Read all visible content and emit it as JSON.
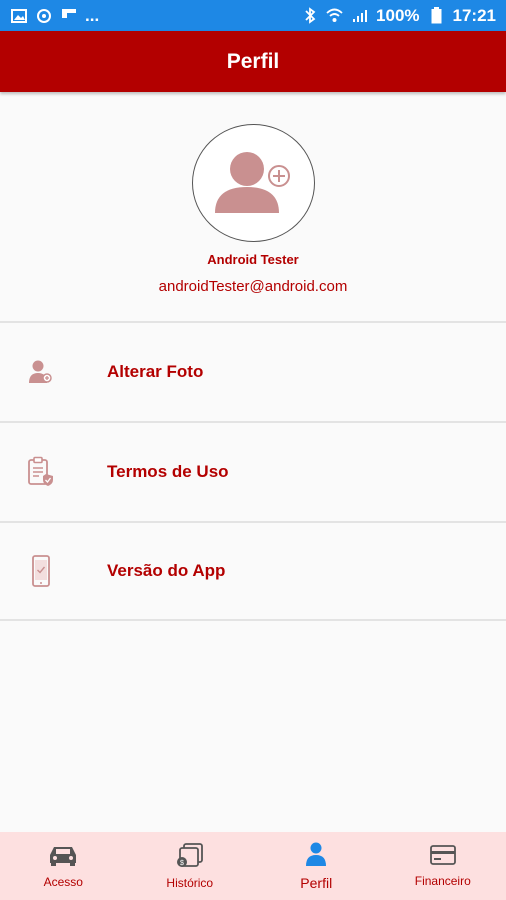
{
  "status_bar": {
    "dots": "...",
    "battery": "100%",
    "time": "17:21"
  },
  "header": {
    "title": "Perfil"
  },
  "profile": {
    "name": "Android Tester",
    "email": "androidTester@android.com"
  },
  "menu": [
    {
      "label": "Alterar Foto",
      "icon": "change-photo-icon"
    },
    {
      "label": "Termos de Uso",
      "icon": "terms-clipboard-icon"
    },
    {
      "label": "Versão do App",
      "icon": "phone-version-icon"
    }
  ],
  "bottom_nav": [
    {
      "label": "Acesso",
      "icon": "car-icon"
    },
    {
      "label": "Histórico",
      "icon": "history-icon"
    },
    {
      "label": "Perfil",
      "icon": "person-icon",
      "active": true
    },
    {
      "label": "Financeiro",
      "icon": "card-icon"
    }
  ],
  "colors": {
    "brand": "#b30000",
    "status_bar": "#1e88e5",
    "active_icon": "#1e88e5",
    "nav_bg": "#fde0e0"
  }
}
